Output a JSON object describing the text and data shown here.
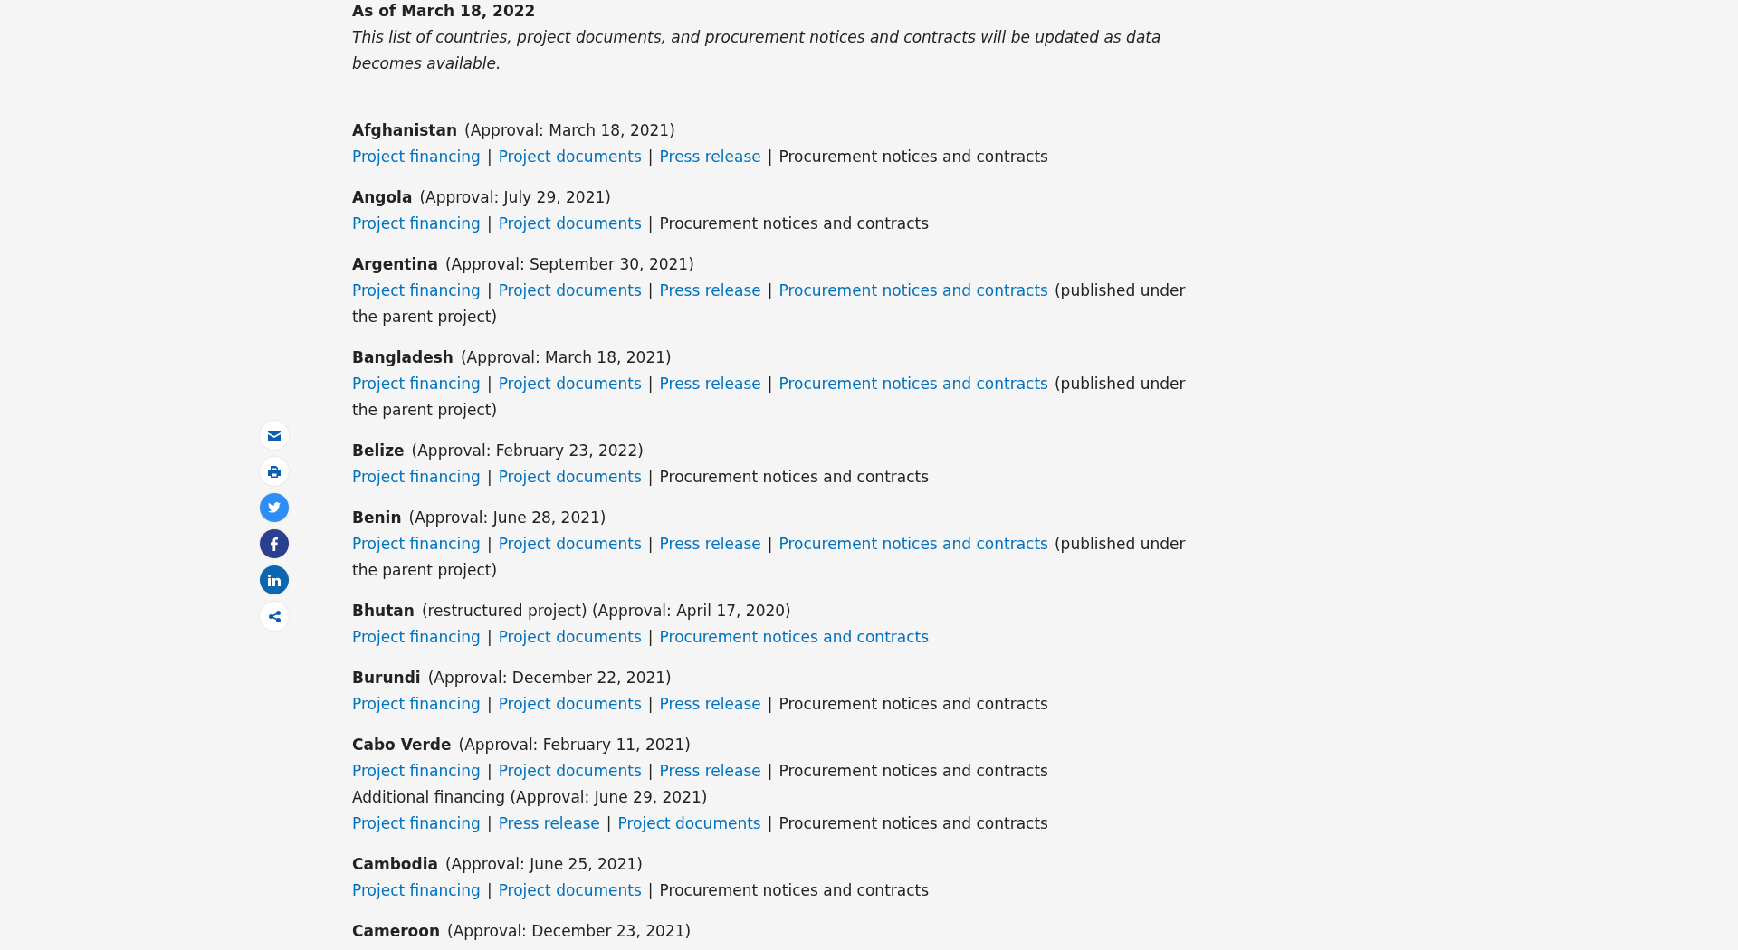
{
  "heading": "As of March 18, 2022",
  "intro": "This list of countries, project documents, and procurement notices and contracts will be updated as data becomes available.",
  "share_buttons": [
    {
      "kind": "email"
    },
    {
      "kind": "print"
    },
    {
      "kind": "twitter"
    },
    {
      "kind": "facebook"
    },
    {
      "kind": "linkedin"
    },
    {
      "kind": "share"
    }
  ],
  "countries": [
    {
      "name": "Afghanistan",
      "note": "(Approval: March 18, 2021)",
      "lines": [
        [
          {
            "kind": "link",
            "text": "Project financing"
          },
          {
            "kind": "sep",
            "text": "|"
          },
          {
            "kind": "link",
            "text": "Project documents"
          },
          {
            "kind": "sep",
            "text": "|"
          },
          {
            "kind": "link",
            "text": "Press release"
          },
          {
            "kind": "sep",
            "text": "|"
          },
          {
            "kind": "plain",
            "text": "Procurement notices and contracts"
          }
        ]
      ]
    },
    {
      "name": "Angola",
      "note": "(Approval: July 29, 2021)",
      "lines": [
        [
          {
            "kind": "link",
            "text": "Project financing"
          },
          {
            "kind": "sep",
            "text": "|"
          },
          {
            "kind": "link",
            "text": "Project documents"
          },
          {
            "kind": "sep",
            "text": "|"
          },
          {
            "kind": "plain",
            "text": "Procurement notices and contracts"
          }
        ]
      ]
    },
    {
      "name": "Argentina",
      "note": "(Approval: September 30, 2021)",
      "lines": [
        [
          {
            "kind": "link",
            "text": "Project financing"
          },
          {
            "kind": "sep",
            "text": "|"
          },
          {
            "kind": "link",
            "text": "Project documents"
          },
          {
            "kind": "sep",
            "text": "|"
          },
          {
            "kind": "link",
            "text": "Press release"
          },
          {
            "kind": "sep",
            "text": "|"
          },
          {
            "kind": "link",
            "text": "Procurement notices and contracts"
          },
          {
            "kind": "plain",
            "text": "(published under the parent project)"
          }
        ]
      ]
    },
    {
      "name": "Bangladesh",
      "note": "(Approval: March 18, 2021)",
      "lines": [
        [
          {
            "kind": "link",
            "text": "Project financing"
          },
          {
            "kind": "sep",
            "text": "|"
          },
          {
            "kind": "link",
            "text": "Project documents"
          },
          {
            "kind": "sep",
            "text": "|"
          },
          {
            "kind": "link",
            "text": "Press release"
          },
          {
            "kind": "sep",
            "text": "|"
          },
          {
            "kind": "link",
            "text": "Procurement notices and contracts"
          },
          {
            "kind": "plain",
            "text": "(published under the parent project)"
          }
        ]
      ]
    },
    {
      "name": "Belize",
      "note": "(Approval: February 23, 2022)",
      "lines": [
        [
          {
            "kind": "link",
            "text": "Project financing"
          },
          {
            "kind": "sep",
            "text": "|"
          },
          {
            "kind": "link",
            "text": "Project documents"
          },
          {
            "kind": "sep",
            "text": "|"
          },
          {
            "kind": "plain",
            "text": "Procurement notices and contracts"
          }
        ]
      ]
    },
    {
      "name": "Benin",
      "note": "(Approval: June 28, 2021)",
      "lines": [
        [
          {
            "kind": "link",
            "text": "Project financing"
          },
          {
            "kind": "sep",
            "text": "|"
          },
          {
            "kind": "link",
            "text": "Project documents"
          },
          {
            "kind": "sep",
            "text": "|"
          },
          {
            "kind": "link",
            "text": "Press release"
          },
          {
            "kind": "sep",
            "text": "|"
          },
          {
            "kind": "link",
            "text": "Procurement notices and contracts"
          },
          {
            "kind": "plain",
            "text": "(published under the parent project)"
          }
        ]
      ]
    },
    {
      "name": "Bhutan",
      "note": "(restructured project) (Approval: April 17, 2020)",
      "lines": [
        [
          {
            "kind": "link",
            "text": "Project financing"
          },
          {
            "kind": "sep",
            "text": "|"
          },
          {
            "kind": "link",
            "text": "Project documents"
          },
          {
            "kind": "sep",
            "text": "|"
          },
          {
            "kind": "link",
            "text": "Procurement notices and contracts"
          }
        ]
      ]
    },
    {
      "name": "Burundi",
      "note": "(Approval: December 22, 2021)",
      "lines": [
        [
          {
            "kind": "link",
            "text": "Project financing"
          },
          {
            "kind": "sep",
            "text": "|"
          },
          {
            "kind": "link",
            "text": "Project documents"
          },
          {
            "kind": "sep",
            "text": "|"
          },
          {
            "kind": "link",
            "text": "Press release"
          },
          {
            "kind": "sep",
            "text": "|"
          },
          {
            "kind": "plain",
            "text": "Procurement notices and contracts"
          }
        ]
      ]
    },
    {
      "name": "Cabo Verde",
      "note": "(Approval: February 11, 2021)",
      "lines": [
        [
          {
            "kind": "link",
            "text": "Project financing"
          },
          {
            "kind": "sep",
            "text": "|"
          },
          {
            "kind": "link",
            "text": "Project documents"
          },
          {
            "kind": "sep",
            "text": "|"
          },
          {
            "kind": "link",
            "text": "Press release"
          },
          {
            "kind": "sep",
            "text": "|"
          },
          {
            "kind": "plain",
            "text": "Procurement notices and contracts"
          }
        ],
        [
          {
            "kind": "plain",
            "text": "Additional financing (Approval: June 29, 2021)"
          }
        ],
        [
          {
            "kind": "link",
            "text": "Project financing"
          },
          {
            "kind": "sep",
            "text": "|"
          },
          {
            "kind": "link",
            "text": "Press release"
          },
          {
            "kind": "sep",
            "text": "|"
          },
          {
            "kind": "link",
            "text": "Project documents"
          },
          {
            "kind": "sep",
            "text": "|"
          },
          {
            "kind": "plain",
            "text": "Procurement notices and contracts"
          }
        ]
      ]
    },
    {
      "name": "Cambodia",
      "note": "(Approval: June 25, 2021)",
      "lines": [
        [
          {
            "kind": "link",
            "text": "Project financing"
          },
          {
            "kind": "sep",
            "text": "|"
          },
          {
            "kind": "link",
            "text": "Project documents"
          },
          {
            "kind": "sep",
            "text": "|"
          },
          {
            "kind": "plain",
            "text": "Procurement notices and contracts"
          }
        ]
      ]
    },
    {
      "name": "Cameroon",
      "note": "(Approval: December 23, 2021)"
    }
  ]
}
